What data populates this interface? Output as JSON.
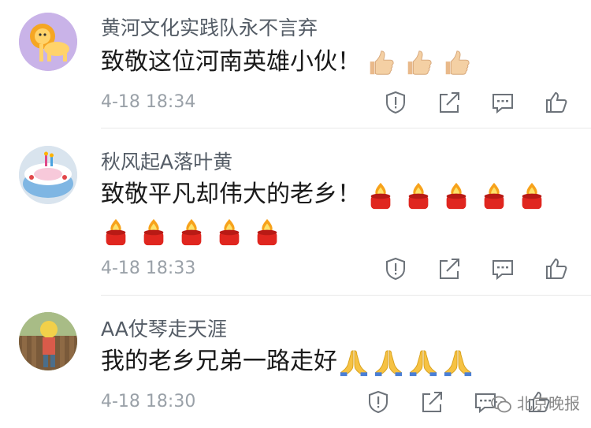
{
  "comments": [
    {
      "username": "黄河文化实践队永不言弃",
      "text": "致敬这位河南英雄小伙！",
      "emoji": "thumbs-up-icon",
      "emoji_count": 3,
      "timestamp": "4-18 18:34",
      "avatar": "lion-avatar"
    },
    {
      "username": "秋风起A落叶黄",
      "text": "致敬平凡却伟大的老乡！",
      "emoji": "candle-icon",
      "emoji_count": 10,
      "timestamp": "4-18 18:33",
      "avatar": "birthday-cake-avatar"
    },
    {
      "username": "AA仗琴走天涯",
      "text": "我的老乡兄弟一路走好",
      "emoji": "praying-hands-icon",
      "emoji_count": 4,
      "timestamp": "4-18 18:30",
      "avatar": "child-photo-avatar"
    }
  ],
  "action_icons": [
    "report-icon",
    "share-icon",
    "reply-icon",
    "like-icon"
  ],
  "watermark": "北京晚报",
  "colors": {
    "username": "#545c66",
    "text": "#1a1a1a",
    "timestamp": "#9aa1a8",
    "avatar_bg_lion": "#c9b3e8",
    "candle_red": "#e0261f",
    "thumb_tone": "#f2cda0",
    "pray_tone": "#f6c243"
  }
}
